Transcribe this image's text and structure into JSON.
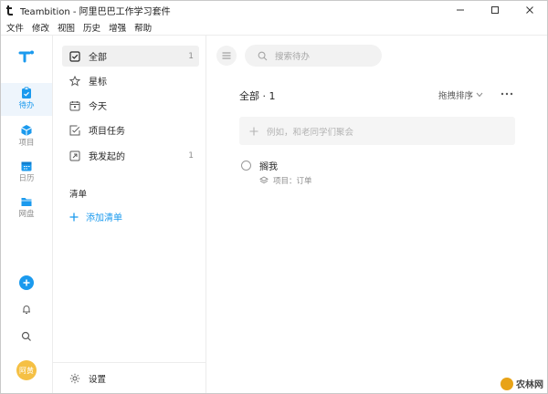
{
  "window": {
    "title": "Teambition - 阿里巴巴工作学习套件",
    "controls": {
      "minimize_icon": "minimize-icon",
      "maximize_icon": "maximize-icon",
      "close_icon": "close-icon"
    }
  },
  "menubar": {
    "items": [
      "文件",
      "修改",
      "视图",
      "历史",
      "增强",
      "帮助"
    ]
  },
  "colors": {
    "accent": "#1b9aee",
    "avatar": "#f5c044",
    "active_bg": "#f0f0f0",
    "rail_active_bg": "#eef5fc",
    "muted_text": "#8c8c8c"
  },
  "rail": {
    "logo_icon": "teambition-logo-icon",
    "items": [
      {
        "label": "待办",
        "icon": "todo-clipboard-icon",
        "active": true
      },
      {
        "label": "项目",
        "icon": "project-cube-icon",
        "active": false
      },
      {
        "label": "日历",
        "icon": "calendar-icon",
        "active": false
      },
      {
        "label": "网盘",
        "icon": "folder-icon",
        "active": false
      }
    ],
    "bottom": {
      "add_icon": "plus-circle-icon",
      "notification_icon": "bell-icon",
      "search_icon": "search-icon",
      "avatar_text": "阿黄"
    }
  },
  "sidebar": {
    "items": [
      {
        "label": "全部",
        "count": "1",
        "icon": "checkbox-icon",
        "active": true
      },
      {
        "label": "星标",
        "count": "",
        "icon": "star-icon",
        "active": false
      },
      {
        "label": "今天",
        "count": "",
        "icon": "calendar-today-icon",
        "active": false
      },
      {
        "label": "项目任务",
        "count": "",
        "icon": "project-task-icon",
        "active": false
      },
      {
        "label": "我发起的",
        "count": "1",
        "icon": "initiated-icon",
        "active": false
      }
    ],
    "section_label": "清单",
    "add_list_label": "添加清单",
    "settings_label": "设置"
  },
  "main": {
    "search_placeholder": "搜索待办",
    "header_title": "全部 · 1",
    "sort_label": "拖拽排序",
    "quick_add_placeholder": "例如，和老同学们聚会",
    "tasks": [
      {
        "title": "搁我",
        "meta": "项目：订单"
      }
    ]
  },
  "watermark": {
    "text": "农林网"
  }
}
